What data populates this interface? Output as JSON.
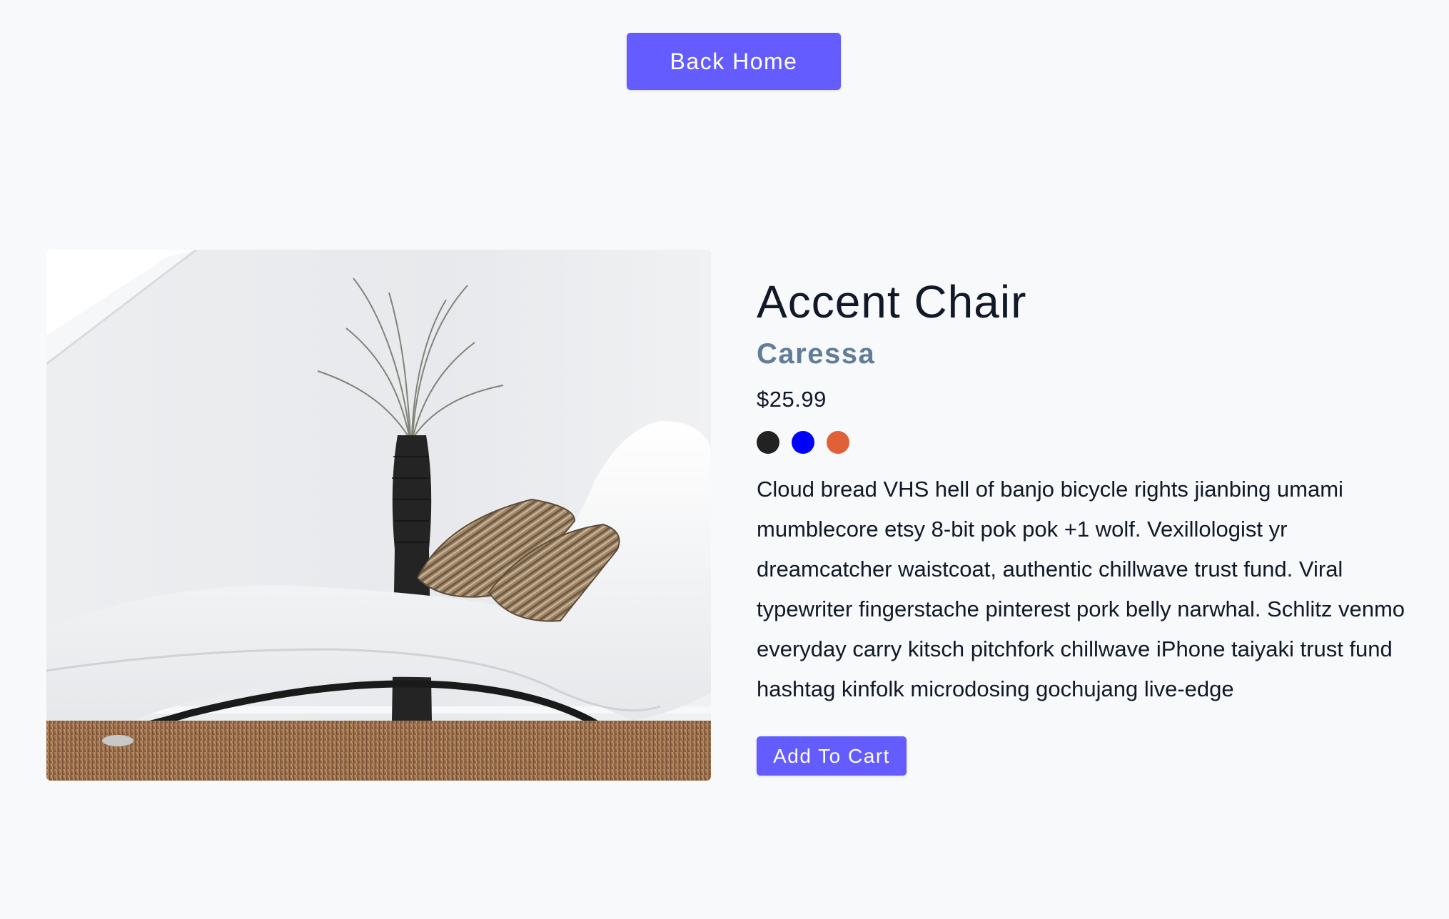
{
  "nav": {
    "back_home_label": "Back Home"
  },
  "product": {
    "title": "Accent Chair",
    "company": "Caressa",
    "price": "$25.99",
    "image_subject": "white-chaise-lounge-photo",
    "colors": [
      "#222222",
      "#0000ff",
      "#e06038"
    ],
    "description": "Cloud bread VHS hell of banjo bicycle rights jianbing umami mumblecore etsy 8-bit pok pok +1 wolf. Vexillologist yr dreamcatcher waistcoat, authentic chillwave trust fund. Viral typewriter fingerstache pinterest pork belly narwhal. Schlitz venmo everyday carry kitsch pitchfork chillwave iPhone taiyaki trust fund hashtag kinfolk microdosing gochujang live-edge",
    "add_to_cart_label": "Add To Cart"
  },
  "theme": {
    "accent": "#645cff",
    "background": "#f8f9fb",
    "company_color": "#617d98"
  }
}
